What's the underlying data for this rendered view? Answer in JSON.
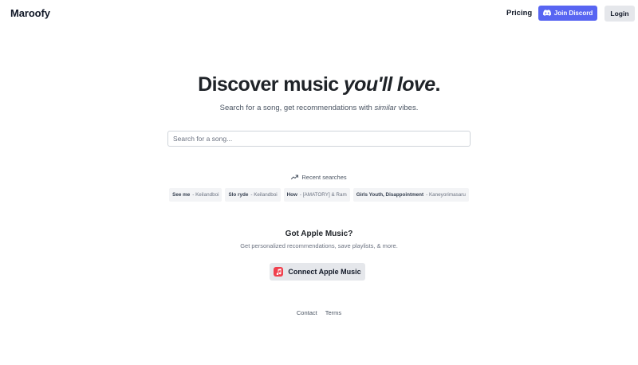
{
  "header": {
    "logo": "Maroofy",
    "pricing": "Pricing",
    "discord": "Join Discord",
    "login": "Login"
  },
  "hero": {
    "title_main": "Discover music ",
    "title_italic": "you'll love",
    "title_end": ".",
    "subtitle_start": "Search for a song, get recommendations with ",
    "subtitle_italic": "similar",
    "subtitle_end": " vibes."
  },
  "search": {
    "placeholder": "Search for a song..."
  },
  "recent": {
    "heading": "Recent searches",
    "items": [
      {
        "song": "See me",
        "artist": "- Keilandboi"
      },
      {
        "song": "Slo ryde",
        "artist": "- Keilandboi"
      },
      {
        "song": "How",
        "artist": "- [AMATORY] & Ram"
      },
      {
        "song": "Girls Youth, Disappointment",
        "artist": "- Kaneyorimasaru"
      }
    ]
  },
  "apple_music": {
    "title": "Got Apple Music?",
    "subtitle": "Get personalized recommendations, save playlists, & more.",
    "button": "Connect Apple Music"
  },
  "footer": {
    "contact": "Contact",
    "terms": "Terms"
  },
  "colors": {
    "discord": "#5865f2",
    "apple_music": "#f0404d"
  },
  "icons": {
    "discord": "discord-icon",
    "trending": "trending-up-icon",
    "apple_music": "apple-music-icon"
  }
}
